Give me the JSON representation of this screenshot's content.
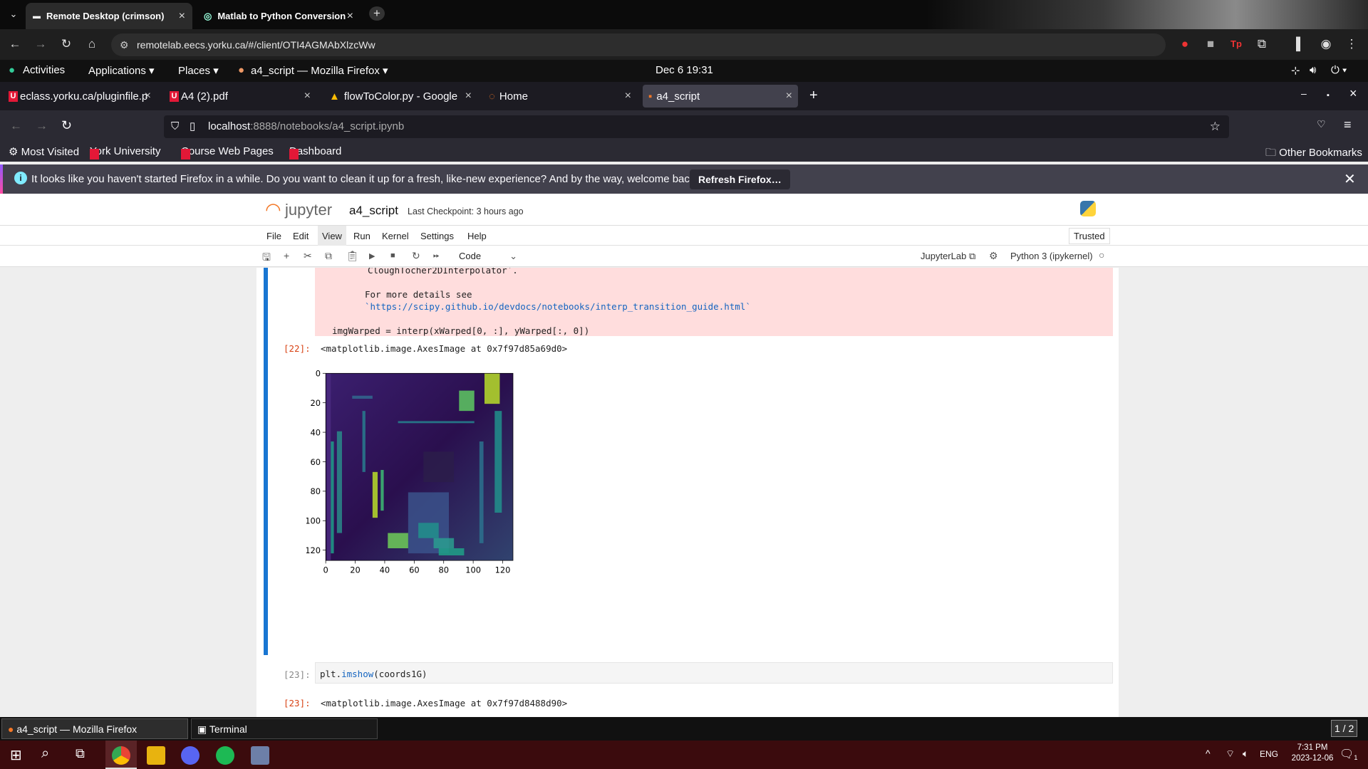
{
  "chrome": {
    "tabs": [
      {
        "label": "Remote Desktop (crimson)"
      },
      {
        "label": "Matlab to Python Conversion"
      }
    ],
    "url": "remotelab.eecs.yorku.ca/#/client/OTI4AGMAbXlzcWw"
  },
  "gnome": {
    "activities": "Activities",
    "applications": "Applications",
    "places": "Places",
    "window": "a4_script — Mozilla Firefox",
    "clock": "Dec 6  19:31"
  },
  "firefox": {
    "tabs": [
      {
        "label": "eclass.yorku.ca/pluginfile.p"
      },
      {
        "label": "A4 (2).pdf"
      },
      {
        "label": "flowToColor.py - Google"
      },
      {
        "label": "Home"
      },
      {
        "label": "a4_script"
      }
    ],
    "url_host": "localhost",
    "url_path": ":8888/notebooks/a4_script.ipynb",
    "bookmarks": [
      "Most Visited",
      "York University",
      "Course Web Pages",
      "Dashboard"
    ],
    "other_bookmarks": "Other Bookmarks",
    "notification": "It looks like you haven't started Firefox in a while. Do you want to clean it up for a fresh, like-new experience? And by the way, welcome back!",
    "refresh_button": "Refresh Firefox…"
  },
  "jupyter": {
    "logo_text": "jupyter",
    "notebook_name": "a4_script",
    "checkpoint": "Last Checkpoint: 3 hours ago",
    "menu": [
      "File",
      "Edit",
      "View",
      "Run",
      "Kernel",
      "Settings",
      "Help"
    ],
    "trusted": "Trusted",
    "cell_type": "Code",
    "jupyterlab": "JupyterLab",
    "kernel": "Python 3 (ipykernel)"
  },
  "cells": {
    "err_line1": "CloughTocher2DInterpolator`.",
    "err_line2": "For more details see",
    "err_link": "`https://scipy.github.io/devdocs/notebooks/interp_transition_guide.html`",
    "err_line3": "imgWarped = interp(xWarped[0, :], yWarped[:, 0])",
    "out22_prompt": "[22]:",
    "out22_text": "<matplotlib.image.AxesImage at 0x7f97d85a69d0>",
    "in23_prompt": "[23]:",
    "in23_code_a": "plt.",
    "in23_code_fn": "imshow",
    "in23_code_b": "(coords1G)",
    "out23_prompt": "[23]:",
    "out23_text": "<matplotlib.image.AxesImage at 0x7f97d8488d90>"
  },
  "chart_data": {
    "type": "heatmap",
    "colormap": "viridis",
    "x_ticks": [
      "0",
      "20",
      "40",
      "60",
      "80",
      "100",
      "120"
    ],
    "y_ticks": [
      "0",
      "20",
      "40",
      "60",
      "80",
      "100",
      "120"
    ],
    "xlim": [
      0,
      127
    ],
    "ylim": [
      127,
      0
    ]
  },
  "taskbar": {
    "items": [
      "a4_script — Mozilla Firefox",
      "Terminal"
    ],
    "workspace": "1 / 2"
  },
  "windows": {
    "lang": "ENG",
    "time": "7:31 PM",
    "date": "2023-12-06",
    "notif_count": "1"
  },
  "colors": {
    "jupyter_orange": "#f37726",
    "selected_cell": "#1976d2",
    "error_bg": "#ffdddd",
    "windows_taskbar": "#3b0b0d"
  }
}
